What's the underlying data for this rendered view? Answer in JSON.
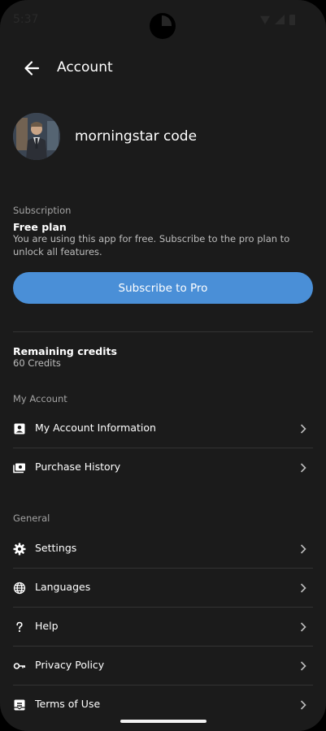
{
  "status_bar": {
    "time": "5:37"
  },
  "header": {
    "title": "Account"
  },
  "profile": {
    "name": "morningstar code"
  },
  "subscription": {
    "section_label": "Subscription",
    "plan_title": "Free plan",
    "plan_description": "You are using this app for free. Subscribe to the pro plan to unlock all features.",
    "subscribe_label": "Subscribe to Pro"
  },
  "credits": {
    "title": "Remaining credits",
    "value": "60 Credits"
  },
  "my_account": {
    "section_label": "My Account",
    "items": [
      {
        "label": "My Account Information",
        "icon": "account-box-icon"
      },
      {
        "label": "Purchase History",
        "icon": "purchase-history-icon"
      }
    ]
  },
  "general": {
    "section_label": "General",
    "items": [
      {
        "label": "Settings",
        "icon": "gear-icon"
      },
      {
        "label": "Languages",
        "icon": "globe-icon"
      },
      {
        "label": "Help",
        "icon": "question-icon"
      },
      {
        "label": "Privacy Policy",
        "icon": "key-icon"
      },
      {
        "label": "Terms of Use",
        "icon": "document-icon"
      }
    ]
  },
  "colors": {
    "background": "#1b1b1b",
    "accent": "#4a8fd7",
    "divider": "#333333",
    "secondary_text": "#a3a3a3"
  }
}
